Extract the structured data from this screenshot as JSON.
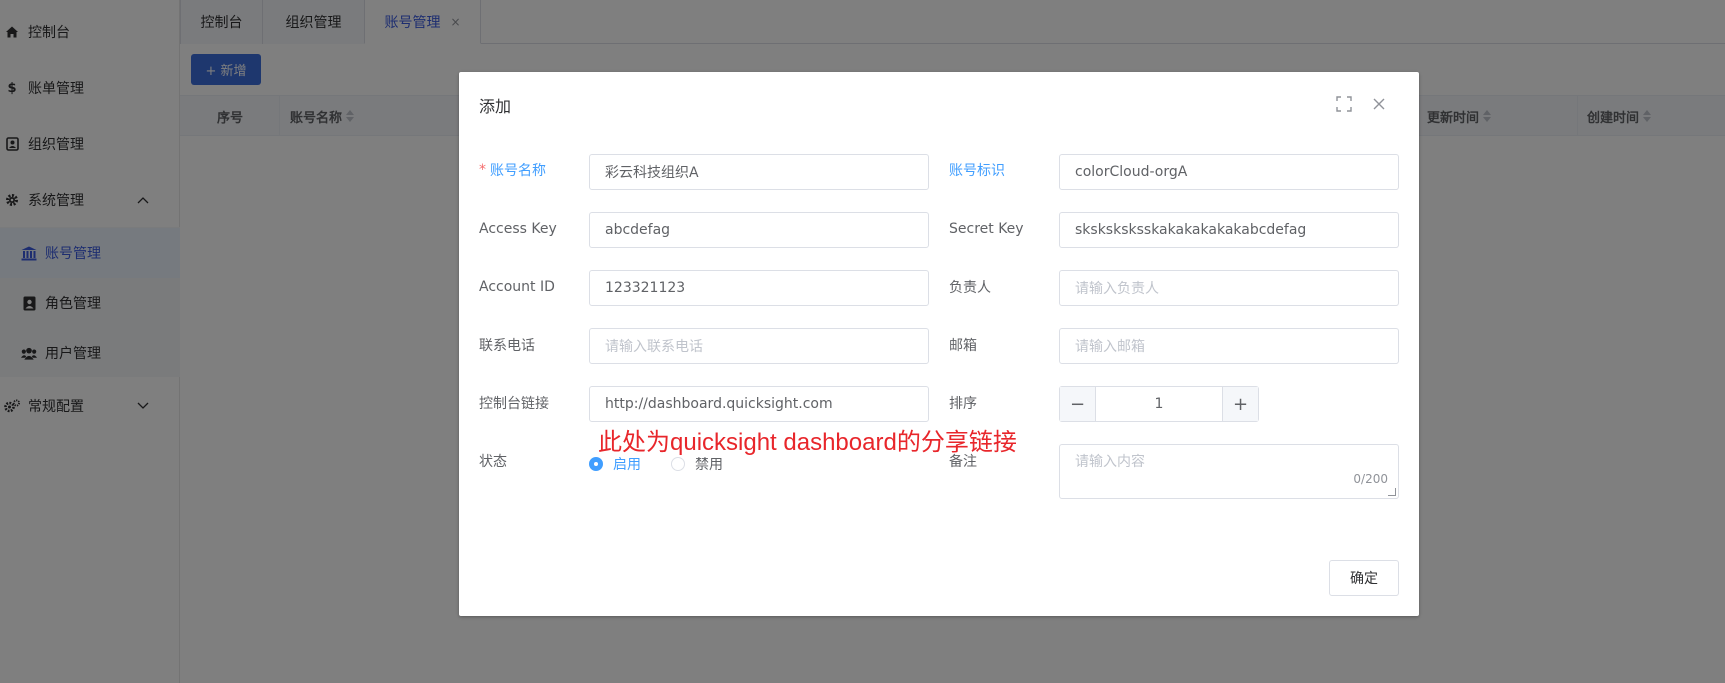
{
  "sidebar": {
    "items": [
      {
        "label": "控制台",
        "icon": "home-icon"
      },
      {
        "label": "账单管理",
        "icon": "dollar-icon"
      },
      {
        "label": "组织管理",
        "icon": "contact-card-icon"
      },
      {
        "label": "系统管理",
        "icon": "gear-icon"
      },
      {
        "label": "常规配置",
        "icon": "gears-icon"
      }
    ],
    "sub_items": [
      {
        "label": "账号管理",
        "icon": "bank-icon"
      },
      {
        "label": "角色管理",
        "icon": "user-badge-icon"
      },
      {
        "label": "用户管理",
        "icon": "users-icon"
      }
    ]
  },
  "tabs": [
    {
      "label": "控制台"
    },
    {
      "label": "组织管理"
    },
    {
      "label": "账号管理",
      "close": "×"
    }
  ],
  "toolbar": {
    "new_label": "+ 新增"
  },
  "table": {
    "columns": [
      "序号",
      "账号名称",
      "更新时间",
      "创建时间"
    ]
  },
  "dialog": {
    "title": "添加",
    "fields": {
      "account_name": {
        "label": "账号名称",
        "required_mark": "*",
        "value": "彩云科技组织A"
      },
      "account_id_tag": {
        "label": "账号标识",
        "value": "colorCloud-orgA"
      },
      "access_key": {
        "label": "Access Key",
        "value": "abcdefag"
      },
      "secret_key": {
        "label": "Secret Key",
        "value": "sksksksksskakakakakakabcdefag"
      },
      "account_id": {
        "label": "Account ID",
        "value": "123321123"
      },
      "owner": {
        "label": "负责人",
        "placeholder": "请输入负责人"
      },
      "phone": {
        "label": "联系电话",
        "placeholder": "请输入联系电话"
      },
      "email": {
        "label": "邮箱",
        "placeholder": "请输入邮箱"
      },
      "console_link": {
        "label": "控制台链接",
        "value": "http://dashboard.quicksight.com"
      },
      "sort": {
        "label": "排序",
        "value": "1",
        "minus": "−",
        "plus": "+"
      },
      "status": {
        "label": "状态",
        "options": [
          "启用",
          "禁用"
        ],
        "selected": "启用"
      },
      "remark": {
        "label": "备注",
        "placeholder": "请输入内容",
        "count": "0/200"
      }
    },
    "annotation": "此处为quicksight dashboard的分享链接",
    "confirm_label": "确定"
  },
  "colors": {
    "accent": "#409eff",
    "primary_button": "#3d6fdc",
    "annotation": "#e8262b"
  }
}
